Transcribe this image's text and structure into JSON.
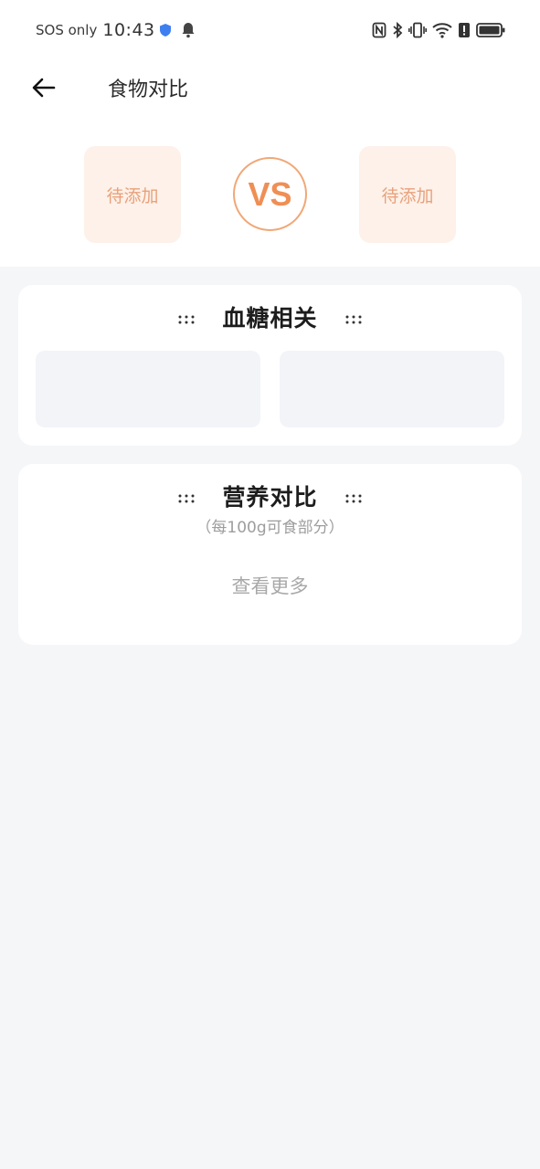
{
  "status_bar": {
    "carrier": "SOS only",
    "time": "10:43",
    "icons": [
      "shield-icon",
      "bell-icon",
      "nfc-icon",
      "bluetooth-icon",
      "vibrate-icon",
      "wifi-icon",
      "alert-icon",
      "battery-icon"
    ]
  },
  "header": {
    "title": "食物对比"
  },
  "compare": {
    "left_slot": "待添加",
    "vs": "VS",
    "right_slot": "待添加"
  },
  "sections": {
    "glucose": {
      "title": "血糖相关"
    },
    "nutrition": {
      "title": "营养对比",
      "subtitle": "（每100g可食部分）",
      "more": "查看更多"
    }
  },
  "colors": {
    "accent": "#ef8f55",
    "slot_bg": "#fdf1e9",
    "page_bg": "#f5f6f8"
  }
}
